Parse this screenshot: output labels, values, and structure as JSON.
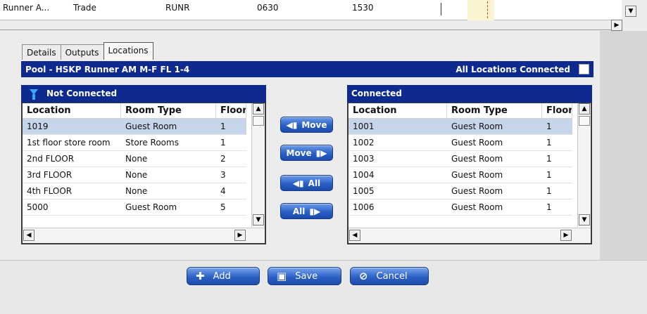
{
  "top_row": {
    "cells": [
      "Runner A...",
      "Trade",
      "RUNR",
      "0630",
      "1530"
    ]
  },
  "tabs": [
    "Details",
    "Outputs",
    "Locations"
  ],
  "active_tab": "Locations",
  "pool": {
    "title": "Pool - HSKP Runner AM M-F FL 1-4",
    "all_connected_label": "All Locations Connected",
    "all_connected_checked": false
  },
  "not_connected": {
    "title": "Not Connected",
    "columns": [
      "Location",
      "Room Type",
      "Floor"
    ],
    "rows": [
      [
        "1019",
        "Guest Room",
        "1"
      ],
      [
        "1st floor store room",
        "Store Rooms",
        "1"
      ],
      [
        "2nd FLOOR",
        "None",
        "2"
      ],
      [
        "3rd FLOOR",
        "None",
        "3"
      ],
      [
        "4th FLOOR",
        "None",
        "4"
      ],
      [
        "5000",
        "Guest Room",
        "5"
      ]
    ],
    "selected_index": 0
  },
  "connected": {
    "title": "Connected",
    "columns": [
      "Location",
      "Room Type",
      "Floor"
    ],
    "rows": [
      [
        "1001",
        "Guest Room",
        "1"
      ],
      [
        "1002",
        "Guest Room",
        "1"
      ],
      [
        "1003",
        "Guest Room",
        "1"
      ],
      [
        "1004",
        "Guest Room",
        "1"
      ],
      [
        "1005",
        "Guest Room",
        "1"
      ],
      [
        "1006",
        "Guest Room",
        "1"
      ]
    ],
    "selected_index": 0
  },
  "move_buttons": {
    "move_left": "Move",
    "move_right": "Move",
    "all_left": "All",
    "all_right": "All"
  },
  "actions": {
    "add": "Add",
    "save": "Save",
    "cancel": "Cancel"
  },
  "colors": {
    "header_blue": "#0e2a8f",
    "selection": "#c6d5ea",
    "button_blue": "#2a5fc4"
  }
}
